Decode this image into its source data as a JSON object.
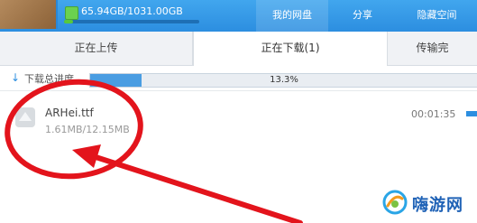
{
  "header": {
    "quota_text": "65.94GB/1031.00GB",
    "quota_fraction": 0.064,
    "tabs": [
      {
        "label": "我的网盘"
      },
      {
        "label": "分享"
      },
      {
        "label": "隐藏空间"
      }
    ]
  },
  "subtabs": [
    {
      "label": "正在上传"
    },
    {
      "label": "正在下载(1)"
    },
    {
      "label": "传输完"
    }
  ],
  "total": {
    "label": "下载总进度",
    "percent_text": "13.3%",
    "fraction": 0.133
  },
  "file": {
    "name": "ARHei.ttf",
    "size": "1.61MB/12.15MB",
    "time": "00:01:35",
    "icon": "file-icon"
  },
  "watermark": {
    "text": "嗨游网"
  },
  "colors": {
    "header_blue": "#2c8ee0",
    "progress_blue": "#4a9de2",
    "annotation_red": "#e3141c",
    "watermark_blue": "#1f62b6"
  }
}
